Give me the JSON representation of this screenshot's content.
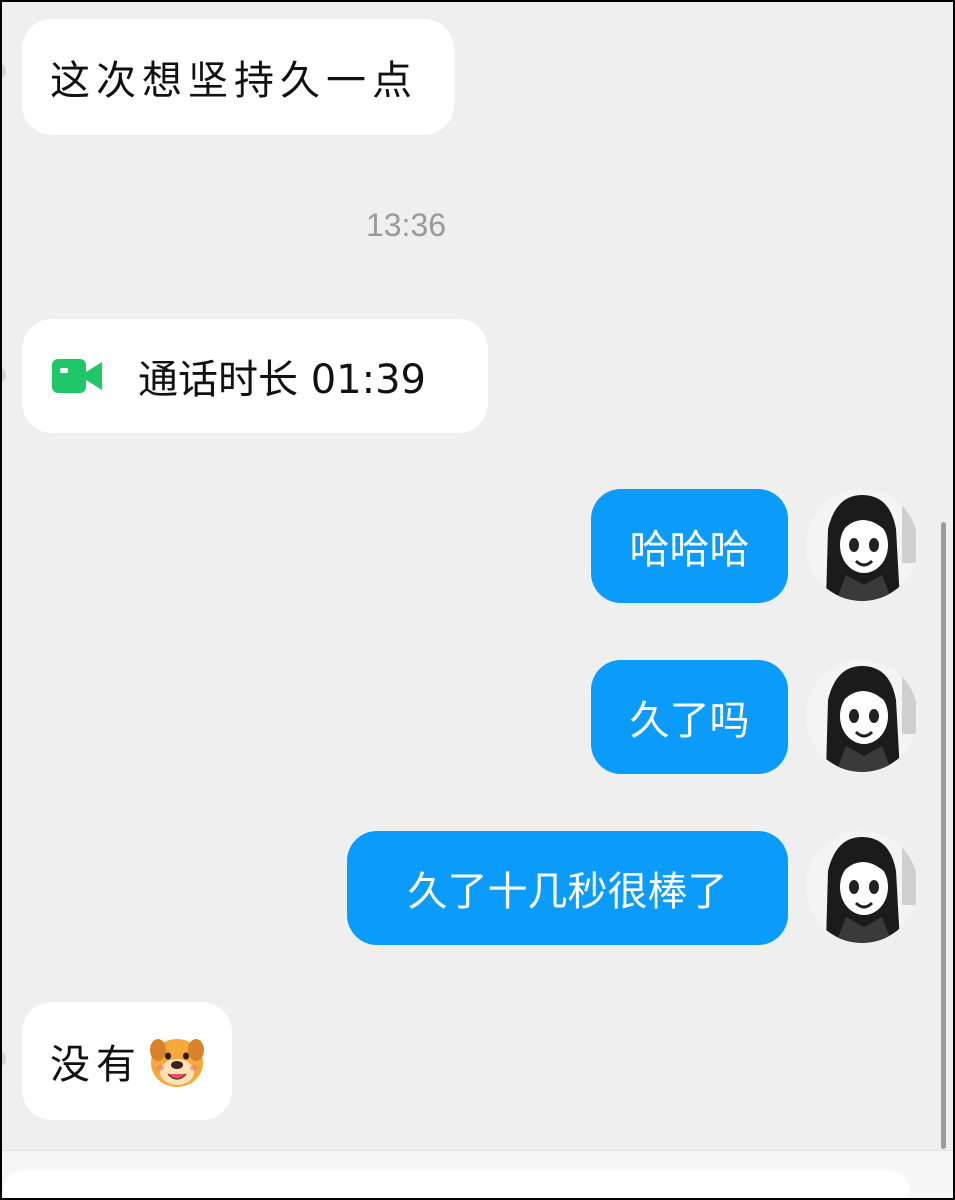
{
  "messages": {
    "incoming_1": {
      "text": "这次想坚持久一点"
    },
    "timestamp": "13:36",
    "call": {
      "label": "通话时长 01:39",
      "icon": "video-camera-icon",
      "icon_color": "#1fc768"
    },
    "outgoing_1": {
      "text": "哈哈哈"
    },
    "outgoing_2": {
      "text": "久了吗"
    },
    "outgoing_3": {
      "text": "久了十几秒很棒了"
    },
    "incoming_2": {
      "text": "没有",
      "emoji": "dog-face-emoji"
    }
  },
  "colors": {
    "background": "#efefef",
    "outgoing_bubble": "#0a9bfb",
    "incoming_bubble": "#ffffff",
    "timestamp": "#9a9a9a"
  }
}
